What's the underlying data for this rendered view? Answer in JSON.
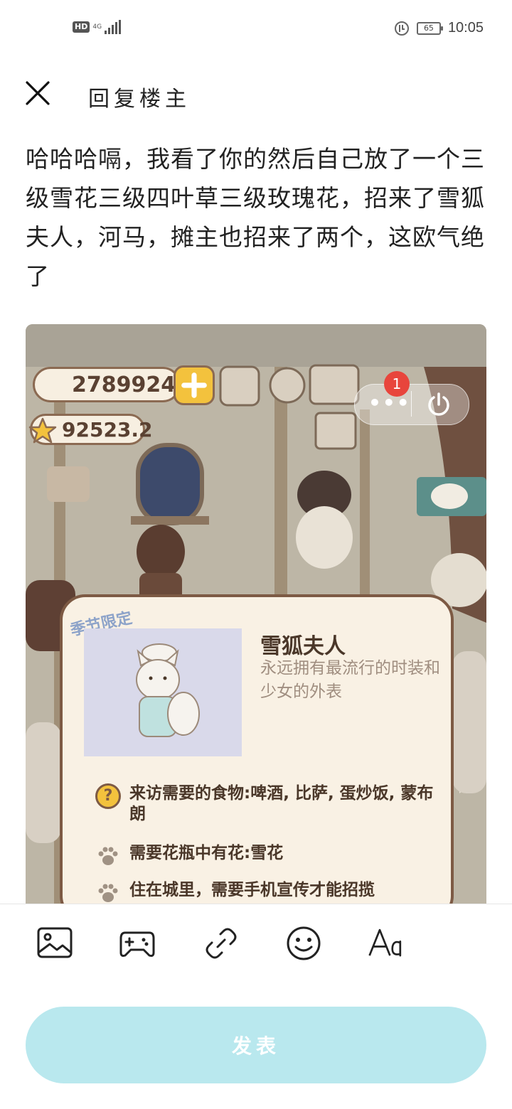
{
  "status_bar": {
    "hd": "HD",
    "network": "4G",
    "battery": "65",
    "time": "10:05"
  },
  "nav": {
    "title": "回复楼主",
    "close_icon": "close-icon"
  },
  "post": {
    "text": "哈哈哈嗝，我看了你的然后自己放了一个三级雪花三级四叶草三级玫瑰花，招来了雪狐夫人，河马，摊主也招来了两个，这欧气绝了"
  },
  "attachment": {
    "fish_count": "2789924",
    "star_count": "92523.2",
    "notification_count": "1",
    "menu_dots": "•••",
    "card": {
      "tag": "季节限定",
      "name": "雪狐夫人",
      "description": "永远拥有最流行的时装和少女的外表",
      "requirements": [
        {
          "icon": "question-icon",
          "symbol": "?",
          "text": "来访需要的食物:啤酒, 比萨, 蛋炒饭, 蒙布朗"
        },
        {
          "icon": "paw-icon",
          "text": "需要花瓶中有花:雪花"
        },
        {
          "icon": "paw-icon",
          "text": "住在城里，需要手机宣传才能招揽"
        }
      ]
    }
  },
  "toolbar": {
    "items": [
      "image-icon",
      "gamepad-icon",
      "link-icon",
      "emoji-icon",
      "text-format-icon"
    ]
  },
  "publish": {
    "label": "发表",
    "color": "#b9e8ee"
  }
}
